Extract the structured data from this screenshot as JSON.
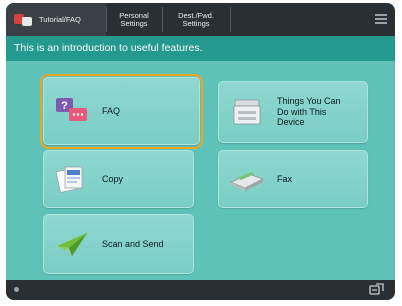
{
  "topbar": {
    "tabs": [
      {
        "label": "Tutorial/FAQ",
        "icon": "tutorial-icon"
      },
      {
        "label": "Personal Settings"
      },
      {
        "label": "Dest./Fwd. Settings"
      }
    ],
    "menu_icon": "hamburger-menu-icon"
  },
  "banner": {
    "text": "This is an introduction to useful features."
  },
  "buttons": [
    {
      "label": "FAQ",
      "icon": "faq-icon",
      "selected": true
    },
    {
      "label": "Things You Can Do with This Device",
      "icon": "multifunction-device-icon"
    },
    {
      "label": "Copy",
      "icon": "copy-icon"
    },
    {
      "label": "Fax",
      "icon": "fax-icon"
    },
    {
      "label": "Scan and Send",
      "icon": "scan-send-icon"
    }
  ],
  "colors": {
    "accent_highlight": "#f2a31c",
    "background": "#5ec2b9",
    "banner": "#23998f",
    "bar": "#2a2f33"
  }
}
